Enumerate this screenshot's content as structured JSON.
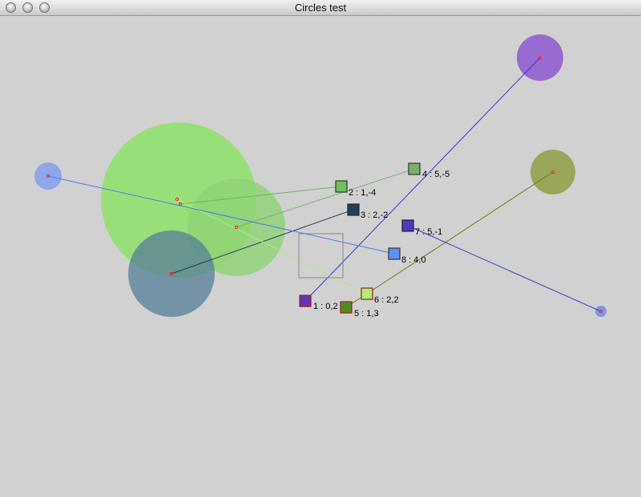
{
  "window": {
    "title": "Circles test",
    "controls": [
      "close",
      "minimize",
      "zoom"
    ]
  },
  "nodes": [
    {
      "label": "1 : 0,2",
      "fill": "#5a37b8",
      "border": "#b01515"
    },
    {
      "label": "2 : 1,-4",
      "fill": "#6fc05a",
      "border": "#333333"
    },
    {
      "label": "3 : 2,-2",
      "fill": "#1f3f5a",
      "border": "#222222"
    },
    {
      "label": "4 : 5,-5",
      "fill": "#7cae6b",
      "border": "#333333"
    },
    {
      "label": "5 : 1,3",
      "fill": "#4e8e1e",
      "border": "#b01515"
    },
    {
      "label": "6 : 2,2",
      "fill": "#a8f07a",
      "border": "#b01515"
    },
    {
      "label": "7 : 5,-1",
      "fill": "#4a3bbf",
      "border": "#222222"
    },
    {
      "label": "8 : 4,0",
      "fill": "#5a94f0",
      "border": "#333333"
    }
  ],
  "colors": {
    "background": "#d1d1d1",
    "center_dot": "#ff2020"
  }
}
